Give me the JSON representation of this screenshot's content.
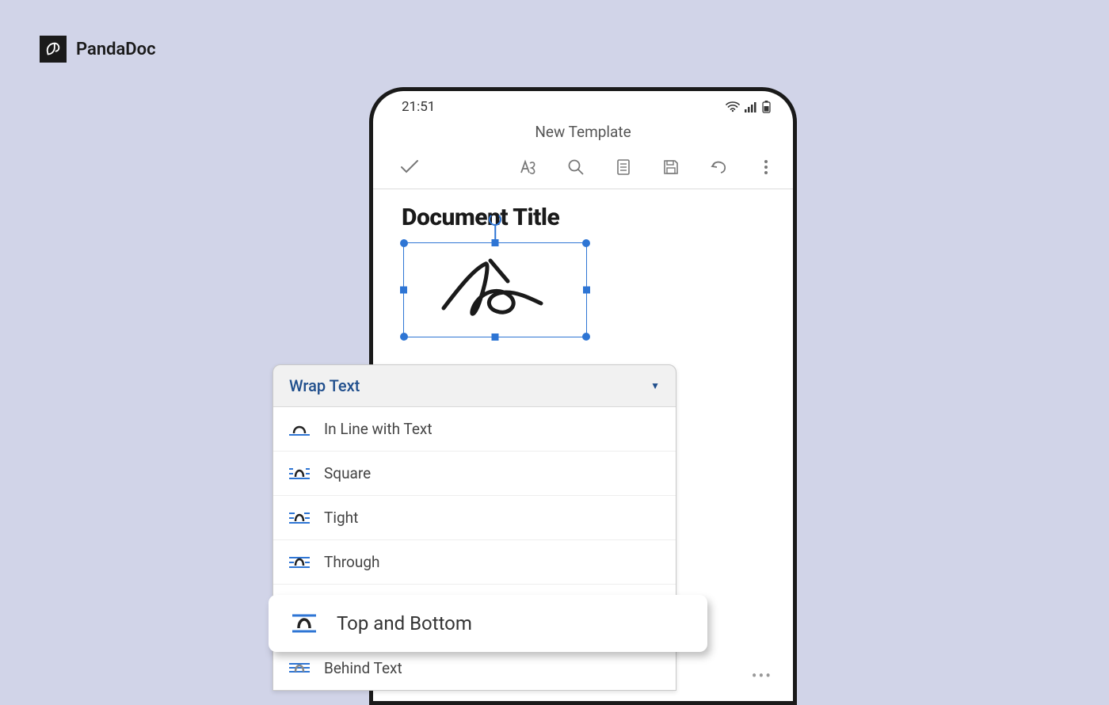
{
  "brand": {
    "name": "PandaDoc"
  },
  "status": {
    "time": "21:51"
  },
  "app": {
    "title": "New Template"
  },
  "document": {
    "title": "Document Title"
  },
  "popup": {
    "title": "Wrap Text",
    "items": [
      {
        "label": "In Line with Text"
      },
      {
        "label": "Square"
      },
      {
        "label": "Tight"
      },
      {
        "label": "Through"
      },
      {
        "label": "Top and Bottom"
      },
      {
        "label": "Behind Text"
      }
    ],
    "highlighted": "Top and Bottom"
  }
}
